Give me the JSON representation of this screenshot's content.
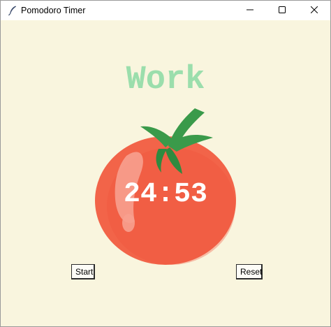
{
  "window": {
    "title": "Pomodoro Timer",
    "icon": "feather-icon"
  },
  "titlebar_buttons": {
    "minimize": "minimize-icon",
    "maximize": "maximize-icon",
    "close": "close-icon"
  },
  "timer": {
    "mode_label": "Work",
    "time_display": "24:53"
  },
  "controls": {
    "start_label": "Start",
    "reset_label": "Reset"
  },
  "colors": {
    "background": "#f9f5de",
    "mode_label": "#9bdeac",
    "tomato": "#f26449",
    "leaf": "#3a9a4a",
    "timer_text": "#ffffff"
  }
}
